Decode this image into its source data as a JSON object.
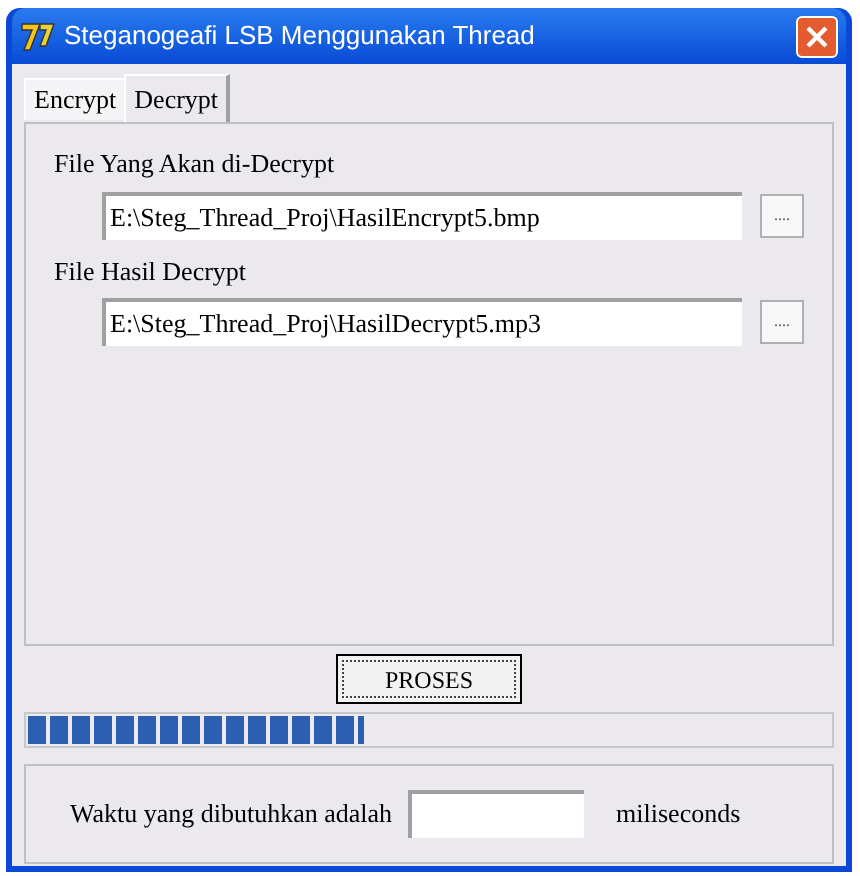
{
  "window": {
    "title": "Steganogeafi LSB Menggunakan Thread"
  },
  "tabs": [
    {
      "label": "Encrypt",
      "selected": false
    },
    {
      "label": "Decrypt",
      "selected": true
    }
  ],
  "fields": [
    {
      "label": "File Yang Akan di-Decrypt",
      "value": "E:\\Steg_Thread_Proj\\HasilEncrypt5.bmp",
      "browse": "...."
    },
    {
      "label": "File Hasil Decrypt",
      "value": "E:\\Steg_Thread_Proj\\HasilDecrypt5.mp3",
      "browse": "...."
    }
  ],
  "process_button": "PROSES",
  "progress": {
    "level": 0.42
  },
  "time": {
    "label": "Waktu yang dibutuhkan adalah",
    "unit": "miliseconds"
  }
}
